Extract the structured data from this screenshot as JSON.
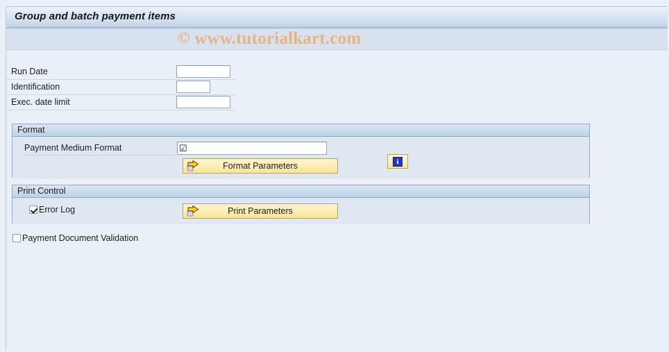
{
  "window": {
    "title": "Group and batch payment items",
    "watermark": "© www.tutorialkart.com"
  },
  "fields": [
    {
      "label": "Run Date",
      "value": "",
      "placeholder": ""
    },
    {
      "label": "Identification",
      "value": "",
      "placeholder": ""
    },
    {
      "label": "Exec. date limit",
      "value": "",
      "placeholder": ""
    }
  ],
  "format_group": {
    "title": "Format",
    "payment_medium_format": {
      "label": "Payment Medium Format",
      "value": "",
      "input_glyph": "☑",
      "glyph_name": "checkbox-checked-icon"
    },
    "info_button": {
      "icon_name": "info-icon",
      "glyph": "i"
    },
    "format_parameters_button": {
      "label": "Format Parameters",
      "icon_name": "arrow-right-icon"
    }
  },
  "print_group": {
    "title": "Print Control",
    "error_log": {
      "label": "Error Log",
      "checked": true
    },
    "print_parameters_button": {
      "label": "Print Parameters",
      "icon_name": "arrow-right-icon"
    }
  },
  "payment_document_validation": {
    "label": "Payment Document Validation",
    "checked": false
  },
  "colors": {
    "page_background": "#eaf0f8",
    "title_bar_start": "#eef3fa",
    "title_bar_end": "#a9bed8",
    "group_border": "#93aac6",
    "group_body": "#dfe8f2",
    "button_yellow": "#fbeeb3",
    "watermark": "#e8b486",
    "info_blue": "#2137c8"
  }
}
